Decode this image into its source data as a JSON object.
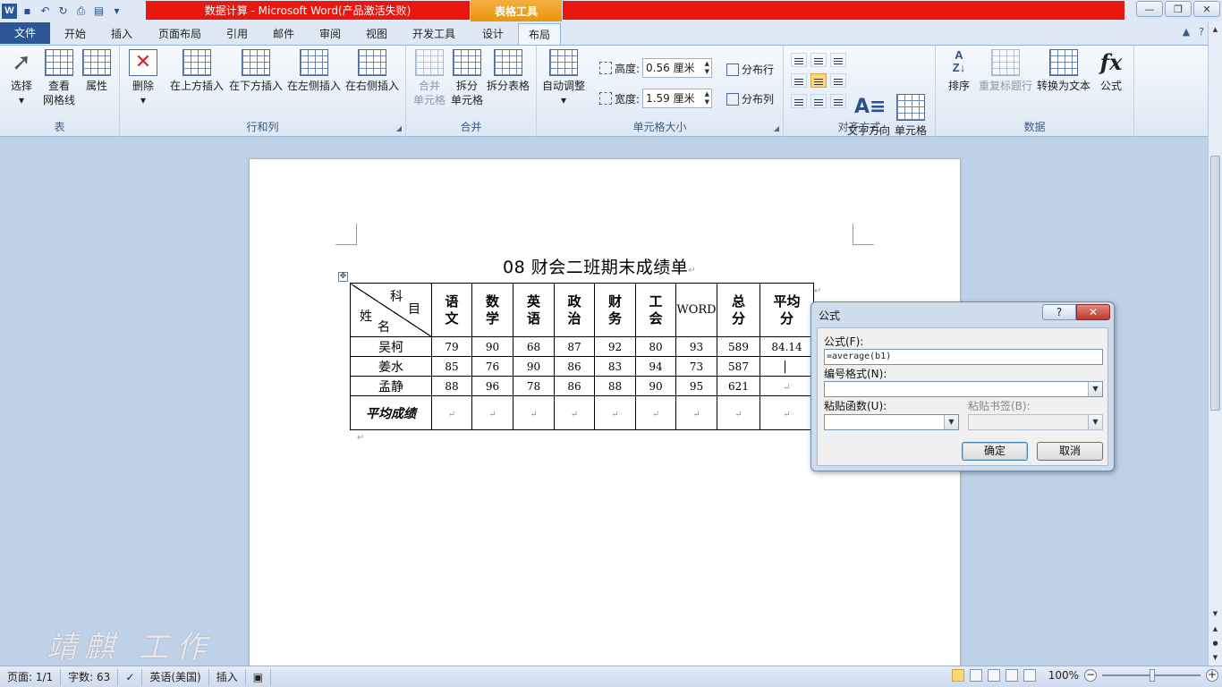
{
  "window": {
    "title": "数据计算 - Microsoft Word(产品激活失败)",
    "contextual_tab_group": "表格工具",
    "controls": [
      "—",
      "❐",
      "✕"
    ]
  },
  "tabs": [
    "文件",
    "开始",
    "插入",
    "页面布局",
    "引用",
    "邮件",
    "审阅",
    "视图",
    "开发工具",
    "设计",
    "布局"
  ],
  "active_tab": "布局",
  "ribbon": {
    "table_group": {
      "label": "表",
      "select": "选择",
      "gridlines": [
        "查看",
        "网格线"
      ],
      "properties": "属性"
    },
    "rows_cols_group": {
      "label": "行和列",
      "delete": "删除",
      "insert_above": "在上方插入",
      "insert_below": "在下方插入",
      "insert_left": "在左侧插入",
      "insert_right": "在右侧插入"
    },
    "merge_group": {
      "label": "合并",
      "merge_cells": [
        "合并",
        "单元格"
      ],
      "split_cells": [
        "拆分",
        "单元格"
      ],
      "split_table": "拆分表格"
    },
    "cell_size_group": {
      "label": "单元格大小",
      "autofit": "自动调整",
      "height_label": "高度:",
      "height_value": "0.56 厘米",
      "width_label": "宽度:",
      "width_value": "1.59 厘米",
      "distribute_rows": "分布行",
      "distribute_cols": "分布列"
    },
    "alignment_group": {
      "label": "对齐方式",
      "text_direction": "文字方向",
      "cell_margins": [
        "单元格",
        "边距"
      ]
    },
    "data_group": {
      "label": "数据",
      "sort": "排序",
      "repeat_header": "重复标题行",
      "convert_to_text": "转换为文本",
      "formula": "公式"
    }
  },
  "document": {
    "title": "08 财会二班期末成绩单",
    "table": {
      "corner": {
        "subject": "科",
        "subject2": "目",
        "name": "姓",
        "name2": "名"
      },
      "headers": [
        [
          "语",
          "文"
        ],
        [
          "数",
          "学"
        ],
        [
          "英",
          "语"
        ],
        [
          "政",
          "治"
        ],
        [
          "财",
          "务"
        ],
        [
          "工",
          "会"
        ],
        [
          "WORD",
          ""
        ],
        [
          "总",
          "分"
        ],
        [
          "平均",
          "分"
        ]
      ],
      "rows": [
        {
          "name": "吴柯",
          "scores": [
            "79",
            "90",
            "68",
            "87",
            "92",
            "80",
            "93",
            "589",
            "84.14"
          ]
        },
        {
          "name": "姜水",
          "scores": [
            "85",
            "76",
            "90",
            "86",
            "83",
            "94",
            "73",
            "587",
            ""
          ]
        },
        {
          "name": "孟静",
          "scores": [
            "88",
            "96",
            "78",
            "86",
            "88",
            "90",
            "95",
            "621",
            ""
          ]
        }
      ],
      "footer_label": "平均成绩"
    }
  },
  "dialog": {
    "title": "公式",
    "help": "?",
    "close": "✕",
    "formula_label": "公式(F):",
    "formula_value": "=average(b1)",
    "number_format_label": "编号格式(N):",
    "paste_function_label": "粘贴函数(U):",
    "paste_bookmark_label": "粘贴书签(B):",
    "ok": "确定",
    "cancel": "取消"
  },
  "statusbar": {
    "page": "页面: 1/1",
    "words": "字数: 63",
    "language": "英语(美国)",
    "mode": "插入",
    "zoom": "100%"
  },
  "watermark": "靖麒 工作",
  "colors": {
    "titlebar_red": "#e8170f",
    "table_tools": "#f0a12a",
    "file_tab": "#2b5797"
  }
}
